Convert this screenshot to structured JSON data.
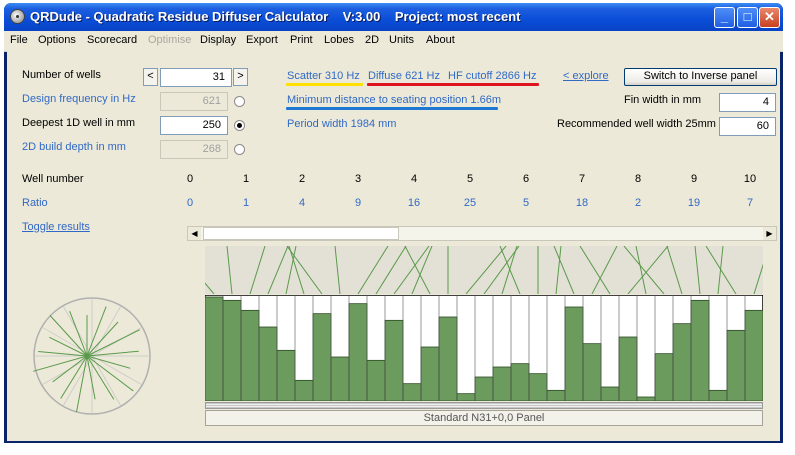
{
  "window": {
    "title": "QRDude - Quadratic Residue Diffuser Calculator    V:3.00    Project: most recent",
    "minimize_glyph": "_",
    "maximize_glyph": "□",
    "close_glyph": "✕"
  },
  "menu": [
    "File",
    "Options",
    "Scorecard",
    "Optimise",
    "Display",
    "Export",
    "Print",
    "Lobes",
    "2D",
    "Units",
    "About"
  ],
  "menu_disabled": [
    "Optimise"
  ],
  "params": {
    "wells_label": "Number of wells",
    "wells_value": "31",
    "spin_left": "<",
    "spin_right": ">",
    "design_freq_label": "Design frequency in Hz",
    "design_freq_value": "621",
    "deepest_label": "Deepest 1D well in mm",
    "deepest_value": "250",
    "build_depth_label": "2D build depth in mm",
    "build_depth_value": "268",
    "selected_radio": "deepest"
  },
  "info": {
    "scatter": "Scatter 310 Hz",
    "diffuse": "Diffuse 621 Hz",
    "hf_cutoff": "HF cutoff 2866 Hz",
    "explore": "< explore",
    "switch_button": "Switch to Inverse panel",
    "min_distance": "Minimum distance to seating position  1.66m",
    "period": "Period width  1984 mm",
    "fin_label": "Fin width in mm",
    "fin_value": "4",
    "rec_label": "Recommended well width  25mm",
    "rec_value": "60",
    "underline_colors": {
      "scatter": "#ffe000",
      "diffuse": "#e0141e",
      "distance": "#1e78d2"
    }
  },
  "table": {
    "well_label": "Well number",
    "ratio_label": "Ratio",
    "wells": [
      "0",
      "1",
      "2",
      "3",
      "4",
      "5",
      "6",
      "7",
      "8",
      "9",
      "10"
    ],
    "ratios": [
      "0",
      "1",
      "4",
      "9",
      "16",
      "25",
      "5",
      "18",
      "2",
      "19",
      "7"
    ]
  },
  "toggle_results": "Toggle results",
  "diffuser": {
    "panel_label": "Standard N31+0,0 Panel",
    "sequence": [
      0,
      1,
      4,
      9,
      16,
      25,
      5,
      18,
      2,
      19,
      7,
      26,
      15,
      6,
      29,
      24,
      21,
      20,
      23,
      28,
      3,
      14,
      27,
      12,
      30,
      17,
      8,
      1,
      28,
      10,
      4
    ],
    "max_ratio": 30,
    "fill_color": "#6c9c5d",
    "line_color": "#5a9a4a"
  }
}
